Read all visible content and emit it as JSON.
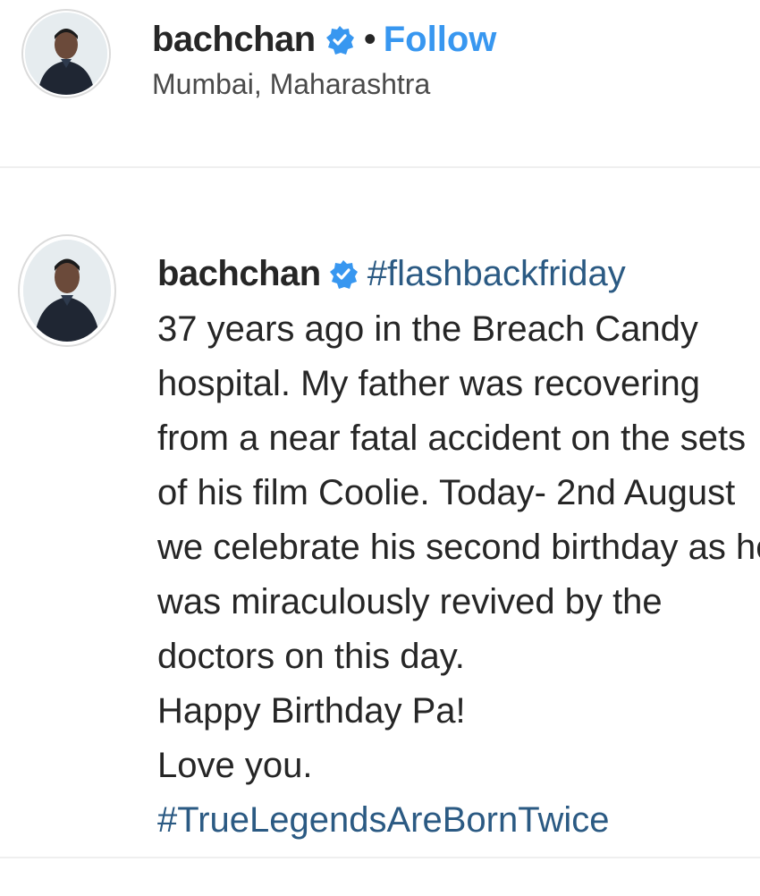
{
  "header": {
    "username": "bachchan",
    "verified_icon": "verified-badge-icon",
    "separator": "•",
    "follow_label": "Follow",
    "location": "Mumbai, Maharashtra"
  },
  "comment": {
    "username": "bachchan",
    "verified_icon": "verified-badge-icon",
    "hashtag_first": "#flashbackfriday",
    "lines": [
      "37 years ago in the Breach Candy",
      "hospital. My father was recovering",
      "from a near fatal accident on the sets",
      "of his film Coolie. Today- 2nd August",
      "we celebrate his second birthday as he",
      "was miraculously revived by the",
      "doctors on this day.",
      "Happy Birthday Pa!",
      "Love you."
    ],
    "hashtag_last": "#TrueLegendsAreBornTwice"
  },
  "colors": {
    "link_blue": "#3897f0",
    "hashtag_blue": "#2b5a83",
    "verified_blue": "#3897f0"
  }
}
